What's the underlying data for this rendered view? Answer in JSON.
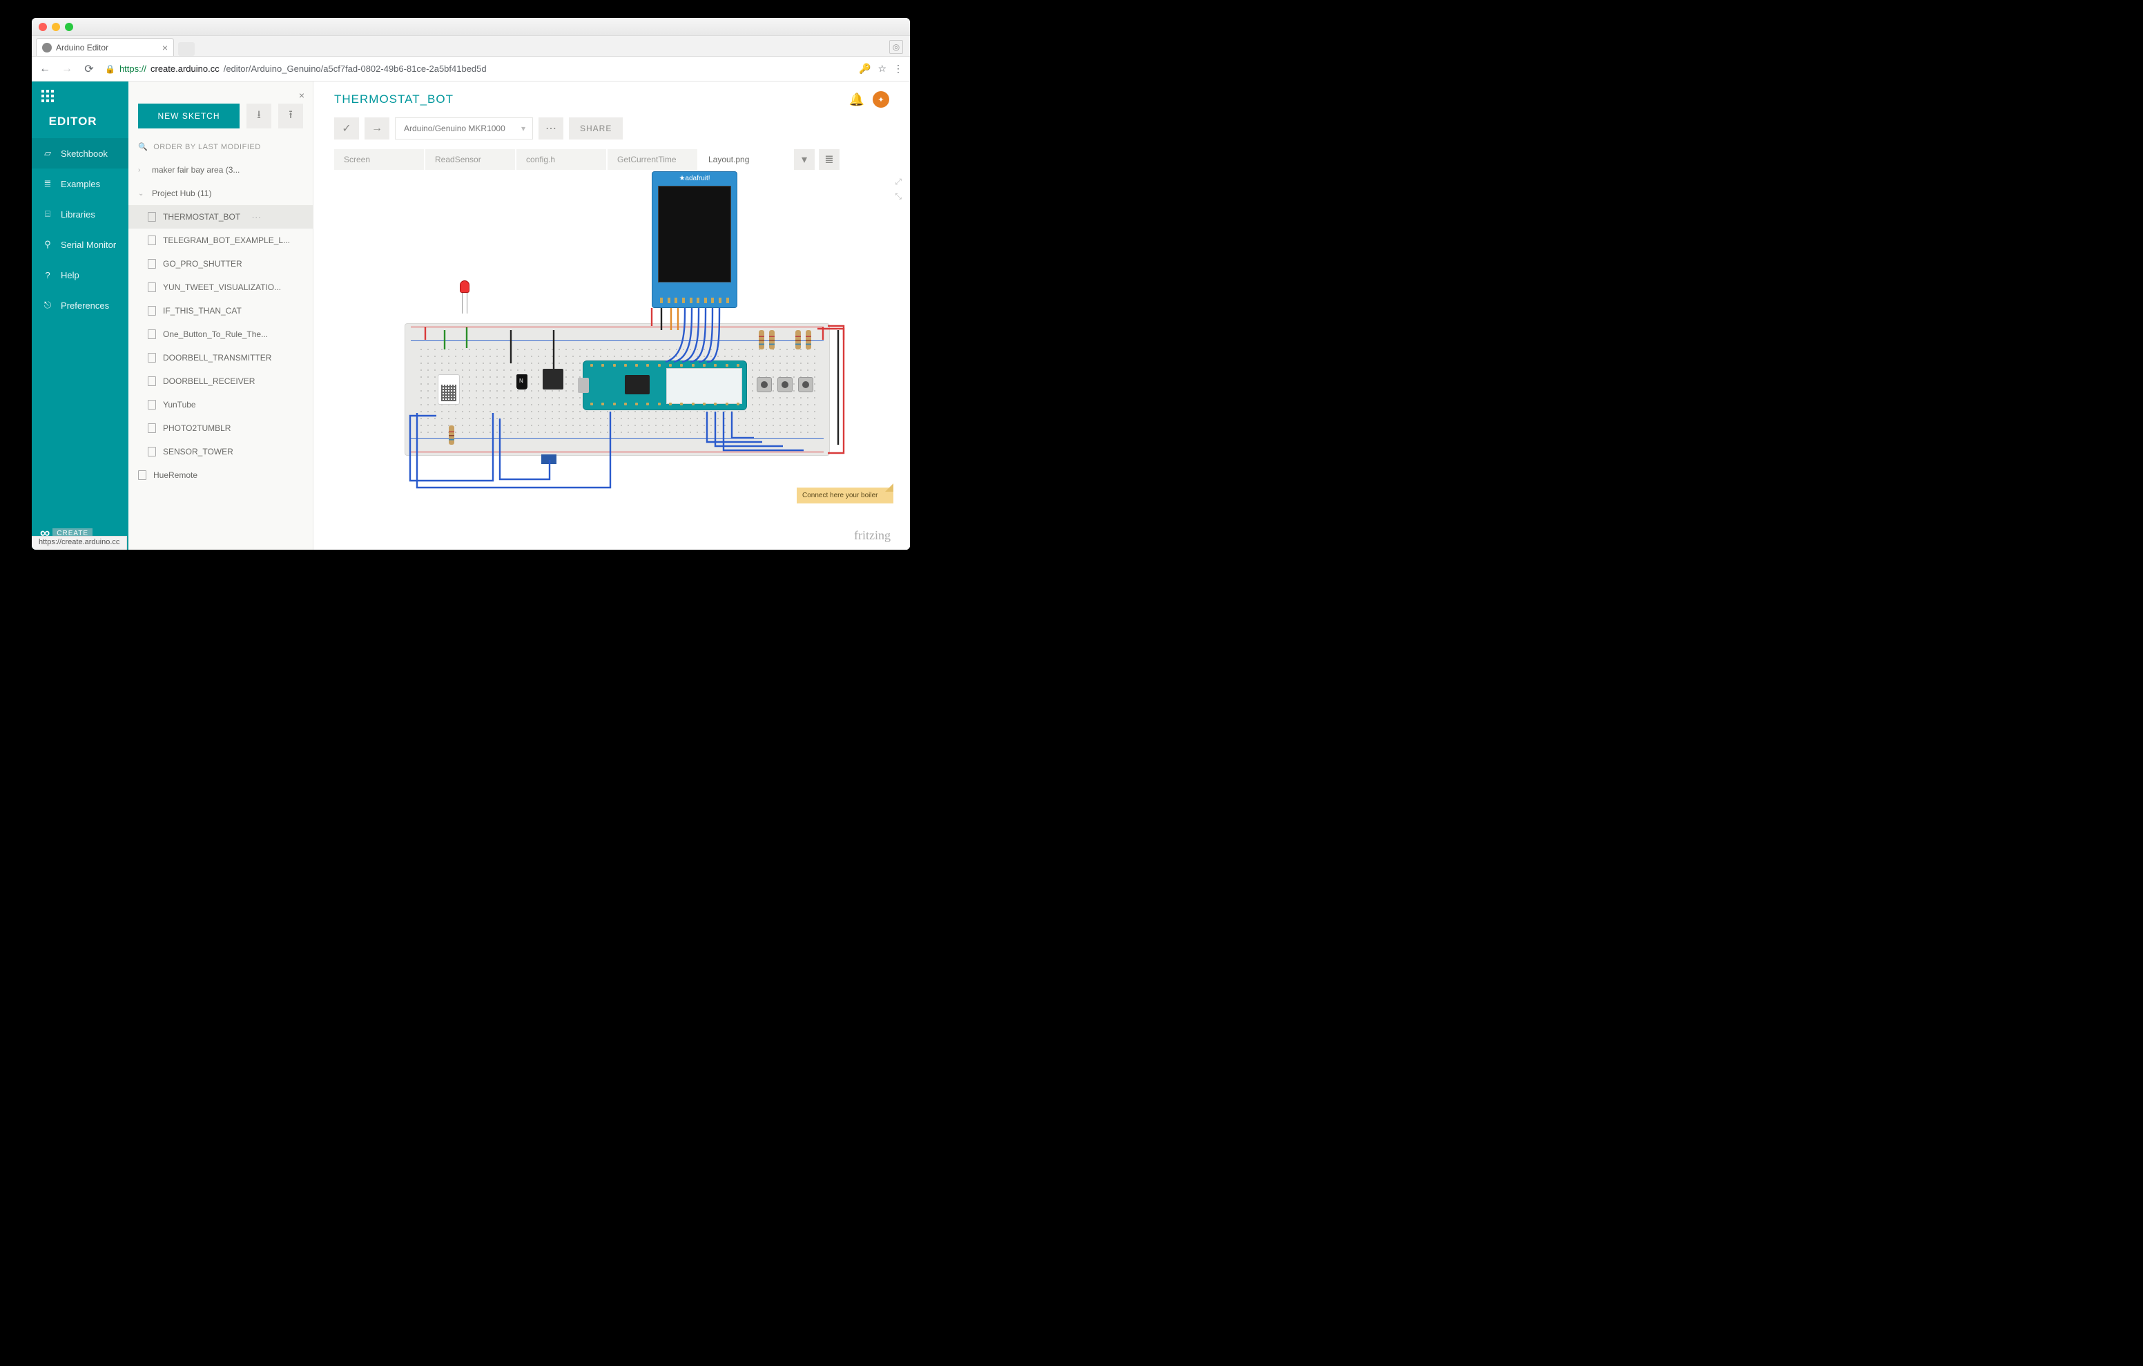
{
  "browser": {
    "tab_title": "Arduino Editor",
    "url_https": "https://",
    "url_host": "create.arduino.cc",
    "url_path": "/editor/Arduino_Genuino/a5cf7fad-0802-49b6-81ce-2a5bf41bed5d",
    "status_url": "https://create.arduino.cc"
  },
  "sidebar": {
    "editor_label": "EDITOR",
    "items": [
      {
        "label": "Sketchbook"
      },
      {
        "label": "Examples"
      },
      {
        "label": "Libraries"
      },
      {
        "label": "Serial Monitor"
      },
      {
        "label": "Help"
      },
      {
        "label": "Preferences"
      }
    ],
    "create_label": "CREATE"
  },
  "sketchbook": {
    "new_sketch": "NEW SKETCH",
    "order_label": "ORDER BY LAST MODIFIED",
    "folders": [
      {
        "name": "maker fair bay area (3...",
        "expanded": false
      },
      {
        "name": "Project Hub (11)",
        "expanded": true,
        "files": [
          "THERMOSTAT_BOT",
          "TELEGRAM_BOT_EXAMPLE_L...",
          "GO_PRO_SHUTTER",
          "YUN_TWEET_VISUALIZATIO...",
          "IF_THIS_THAN_CAT",
          "One_Button_To_Rule_The...",
          "DOORBELL_TRANSMITTER",
          "DOORBELL_RECEIVER",
          "YunTube",
          "PHOTO2TUMBLR",
          "SENSOR_TOWER"
        ]
      }
    ],
    "loose_file": "HueRemote",
    "selected": "THERMOSTAT_BOT"
  },
  "main": {
    "title": "THERMOSTAT_BOT",
    "board": "Arduino/Genuino MKR1000",
    "share": "SHARE",
    "tabs": [
      "Screen",
      "ReadSensor",
      "config.h",
      "GetCurrentTime",
      "Layout.png"
    ],
    "active_tab": "Layout.png",
    "note": "Connect here your boiler",
    "tft_label": "★adafruit!",
    "fritzing": "fritzing"
  }
}
